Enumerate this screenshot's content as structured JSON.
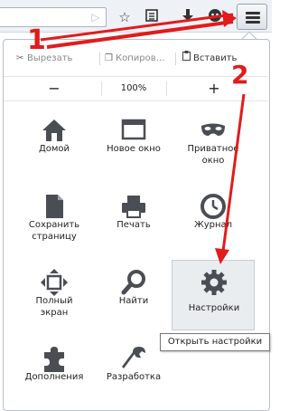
{
  "toolbar": {
    "url_go_icon": "arrow-right-icon",
    "icons": [
      "star-icon",
      "reading-list-icon",
      "download-icon",
      "avatar-icon"
    ],
    "menu_icon": "hamburger-icon"
  },
  "edit_row": {
    "cut": "Вырезать",
    "copy": "Копиров…",
    "paste": "Вставить"
  },
  "zoom": {
    "minus": "−",
    "value": "100%",
    "plus": "+"
  },
  "tiles": [
    {
      "label": "Домой",
      "icon": "home-icon"
    },
    {
      "label": "Новое окно",
      "icon": "new-window-icon"
    },
    {
      "label": "Приватное\nокно",
      "icon": "private-mask-icon"
    },
    {
      "label": "Сохранить\nстраницу",
      "icon": "save-page-icon"
    },
    {
      "label": "Печать",
      "icon": "print-icon"
    },
    {
      "label": "Журнал",
      "icon": "history-clock-icon"
    },
    {
      "label": "Полный\nэкран",
      "icon": "fullscreen-icon"
    },
    {
      "label": "Найти",
      "icon": "search-icon"
    },
    {
      "label": "Настройки",
      "icon": "settings-gear-icon"
    },
    {
      "label": "Дополнения",
      "icon": "addons-puzzle-icon"
    },
    {
      "label": "Разработка",
      "icon": "developer-wrench-icon"
    }
  ],
  "tooltip": "Открыть настройки",
  "annotations": {
    "step1": "1",
    "step2": "2",
    "color": "#e21b1b"
  }
}
